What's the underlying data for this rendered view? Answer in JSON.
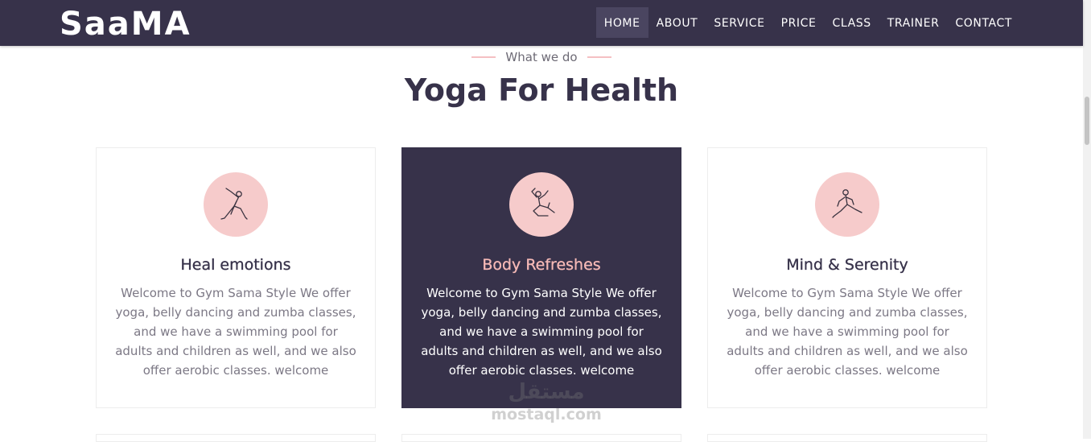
{
  "brand": {
    "logo": "SaaMA"
  },
  "nav": {
    "items": [
      {
        "label": "HOME",
        "active": true
      },
      {
        "label": "ABOUT"
      },
      {
        "label": "SERVICE"
      },
      {
        "label": "PRICE"
      },
      {
        "label": "CLASS"
      },
      {
        "label": "TRAINER"
      },
      {
        "label": "CONTACT"
      }
    ]
  },
  "section": {
    "tagline": "What we do",
    "title": "Yoga For Health"
  },
  "cards": [
    {
      "icon": "yoga-triangle-pose-icon",
      "title": "Heal emotions",
      "text": "Welcome to Gym Sama Style We offer yoga, belly dancing and zumba classes, and we have a swimming pool for adults and children as well, and we also offer aerobic classes. welcome",
      "highlighted": false
    },
    {
      "icon": "yoga-seated-pose-icon",
      "title": "Body Refreshes",
      "text": "Welcome to Gym Sama Style We offer yoga, belly dancing and zumba classes, and we have a swimming pool for adults and children as well, and we also offer aerobic classes. welcome",
      "highlighted": true
    },
    {
      "icon": "yoga-lunge-pose-icon",
      "title": "Mind & Serenity",
      "text": "Welcome to Gym Sama Style We offer yoga, belly dancing and zumba classes, and we have a swimming pool for adults and children as well, and we also offer aerobic classes. welcome",
      "highlighted": false
    }
  ],
  "watermark": {
    "logo": "مستقل",
    "text": "mostaql.com"
  },
  "colors": {
    "navbar": "#37324a",
    "accent_pink": "#f6cbcb",
    "dark_card": "#37324a",
    "title_pink": "#f5b9b6"
  }
}
